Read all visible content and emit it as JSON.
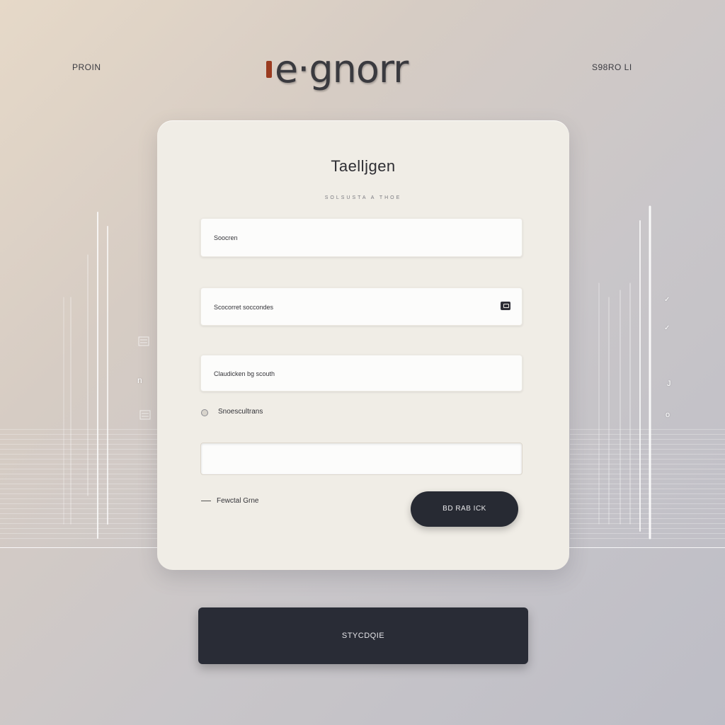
{
  "header": {
    "left_label": "PROIN",
    "logo_text": "e·gnorr",
    "right_label": "S98RO LI"
  },
  "card": {
    "title": "Taelljgen",
    "subtitle": "SOLSUSTA A THOE",
    "fields": [
      {
        "placeholder": "Soocren"
      },
      {
        "placeholder": "Scocorret soccondes",
        "icon": "password-toggle-icon"
      },
      {
        "placeholder": "Claudicken bg scouth"
      },
      {
        "placeholder": ""
      }
    ],
    "checkbox_label": "Snoescultrans",
    "footer_link": "Fewctal Grne",
    "primary_button": "BD RAB ICK"
  },
  "bottom_button": "STYCDQIE",
  "side_glyphs": {
    "left": [
      "n"
    ],
    "right": [
      "✓",
      "✓",
      "J",
      "o"
    ]
  },
  "colors": {
    "card_bg": "#f0ede6",
    "button_dark": "#272a33"
  }
}
